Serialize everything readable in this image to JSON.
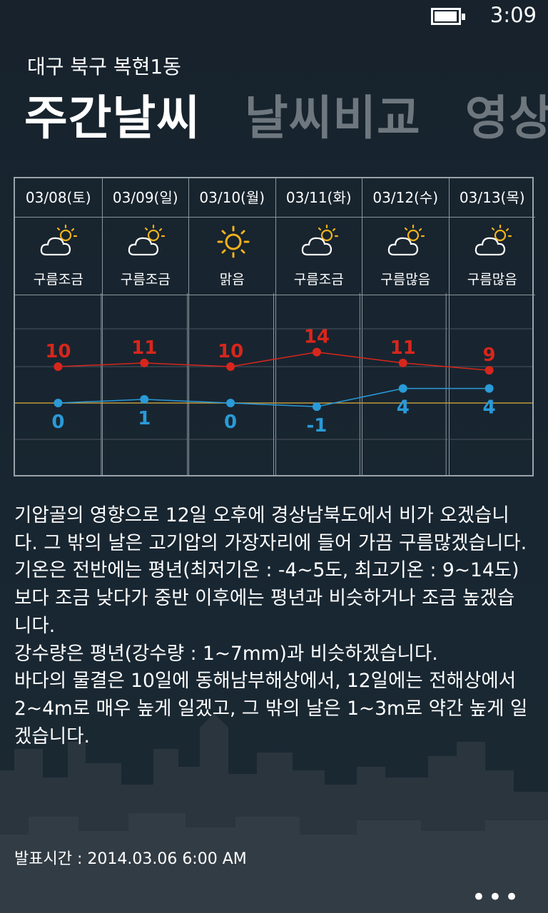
{
  "status_bar": {
    "time": "3:09",
    "battery_level": 0.85
  },
  "header": {
    "location": "대구 북구 복현1동",
    "tabs": [
      {
        "label": "주간날씨",
        "active": true
      },
      {
        "label": "날씨비교",
        "active": false
      },
      {
        "label": "영상",
        "active": false
      }
    ]
  },
  "forecast": {
    "days": [
      {
        "date": "03/08(토)",
        "icon": "partly-cloudy-icon",
        "condition": "구름조금",
        "high": "10",
        "low": "0"
      },
      {
        "date": "03/09(일)",
        "icon": "partly-cloudy-icon",
        "condition": "구름조금",
        "high": "11",
        "low": "1"
      },
      {
        "date": "03/10(월)",
        "icon": "sun-icon",
        "condition": "맑음",
        "high": "10",
        "low": "0"
      },
      {
        "date": "03/11(화)",
        "icon": "partly-cloudy-icon",
        "condition": "구름조금",
        "high": "14",
        "low": "-1"
      },
      {
        "date": "03/12(수)",
        "icon": "partly-cloudy-icon",
        "condition": "구름많음",
        "high": "11",
        "low": "4"
      },
      {
        "date": "03/13(목)",
        "icon": "partly-cloudy-icon",
        "condition": "구름많음",
        "high": "9",
        "low": "4"
      }
    ]
  },
  "chart_data": {
    "type": "line",
    "categories": [
      "03/08(토)",
      "03/09(일)",
      "03/10(월)",
      "03/11(화)",
      "03/12(수)",
      "03/13(목)"
    ],
    "series": [
      {
        "values": [
          10,
          11,
          10,
          14,
          11,
          9
        ],
        "color": "#d8261c"
      },
      {
        "values": [
          0,
          1,
          0,
          -1,
          4,
          4
        ],
        "color": "#2a9ad8"
      }
    ],
    "zero_line_color": "#c09a3a",
    "grid": true
  },
  "description": {
    "paragraphs": [
      "기압골의 영향으로 12일 오후에 경상남북도에서 비가 오겠습니다. 그 밖의 날은 고기압의 가장자리에 들어 가끔 구름많겠습니다.",
      "기온은 전반에는 평년(최저기온 : -4~5도, 최고기온 : 9~14도)보다 조금 낮다가 중반 이후에는 평년과 비슷하거나 조금 높겠습니다.",
      "강수량은 평년(강수량 : 1~7mm)과 비슷하겠습니다.",
      "바다의 물결은 10일에 동해남부해상에서, 12일에는 전해상에서 2~4m로 매우 높게 일겠고, 그 밖의 날은 1~3m로 약간 높게 일겠습니다."
    ]
  },
  "issued": "발표시간 : 2014.03.06 6:00 AM",
  "app_bar": {
    "more_label": "•••"
  }
}
